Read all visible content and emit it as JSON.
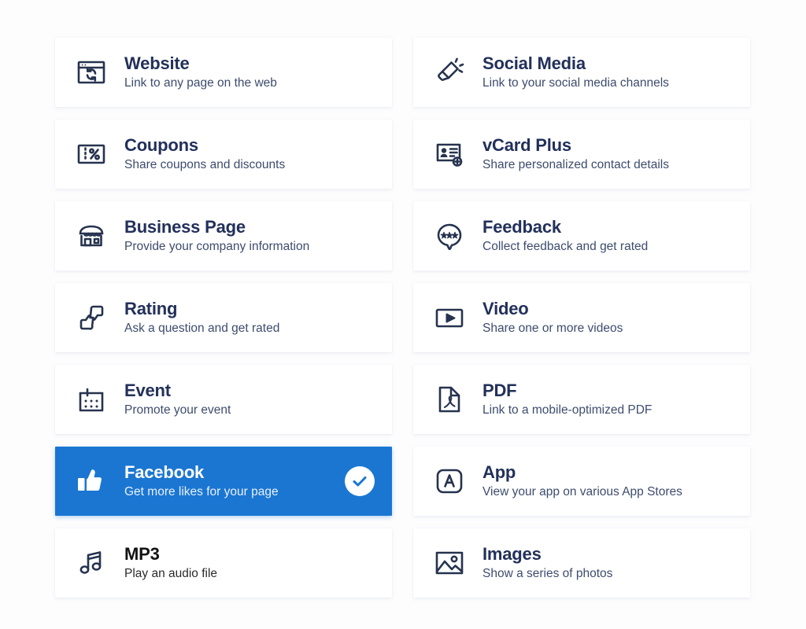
{
  "page": {
    "background_color": "#fdfdfe",
    "card_background": "#ffffff",
    "accent_color": "#1b76d2",
    "title_color": "#22305a",
    "subtitle_color": "#3d4c6d"
  },
  "columns": {
    "left": [
      {
        "icon": "browser-refresh-icon",
        "title": "Website",
        "subtitle": "Link to any page on the web",
        "selected": false
      },
      {
        "icon": "coupon-percent-icon",
        "title": "Coupons",
        "subtitle": "Share coupons and discounts",
        "selected": false
      },
      {
        "icon": "storefront-icon",
        "title": "Business Page",
        "subtitle": "Provide your company information",
        "selected": false
      },
      {
        "icon": "thumbs-up-down-icon",
        "title": "Rating",
        "subtitle": "Ask a question and get rated",
        "selected": false
      },
      {
        "icon": "calendar-icon",
        "title": "Event",
        "subtitle": "Promote your event",
        "selected": false
      },
      {
        "icon": "thumbs-up-solid-icon",
        "title": "Facebook",
        "subtitle": "Get more likes for your page",
        "selected": true,
        "badge": "check-circle-icon"
      },
      {
        "icon": "music-note-icon",
        "title": "MP3",
        "subtitle": "Play an audio file",
        "selected": false
      }
    ],
    "right": [
      {
        "icon": "megaphone-icon",
        "title": "Social Media",
        "subtitle": "Link to your social media channels",
        "selected": false
      },
      {
        "icon": "contact-card-plus-icon",
        "title": "vCard Plus",
        "subtitle": "Share personalized contact details",
        "selected": false
      },
      {
        "icon": "speech-bubble-stars-icon",
        "title": "Feedback",
        "subtitle": "Collect feedback and get rated",
        "selected": false
      },
      {
        "icon": "video-play-icon",
        "title": "Video",
        "subtitle": "Share one or more videos",
        "selected": false
      },
      {
        "icon": "pdf-document-icon",
        "title": "PDF",
        "subtitle": "Link to a mobile-optimized PDF",
        "selected": false
      },
      {
        "icon": "app-square-a-icon",
        "title": "App",
        "subtitle": "View your app on various App Stores",
        "selected": false
      },
      {
        "icon": "image-photo-icon",
        "title": "Images",
        "subtitle": "Show a series of photos",
        "selected": false
      }
    ]
  }
}
